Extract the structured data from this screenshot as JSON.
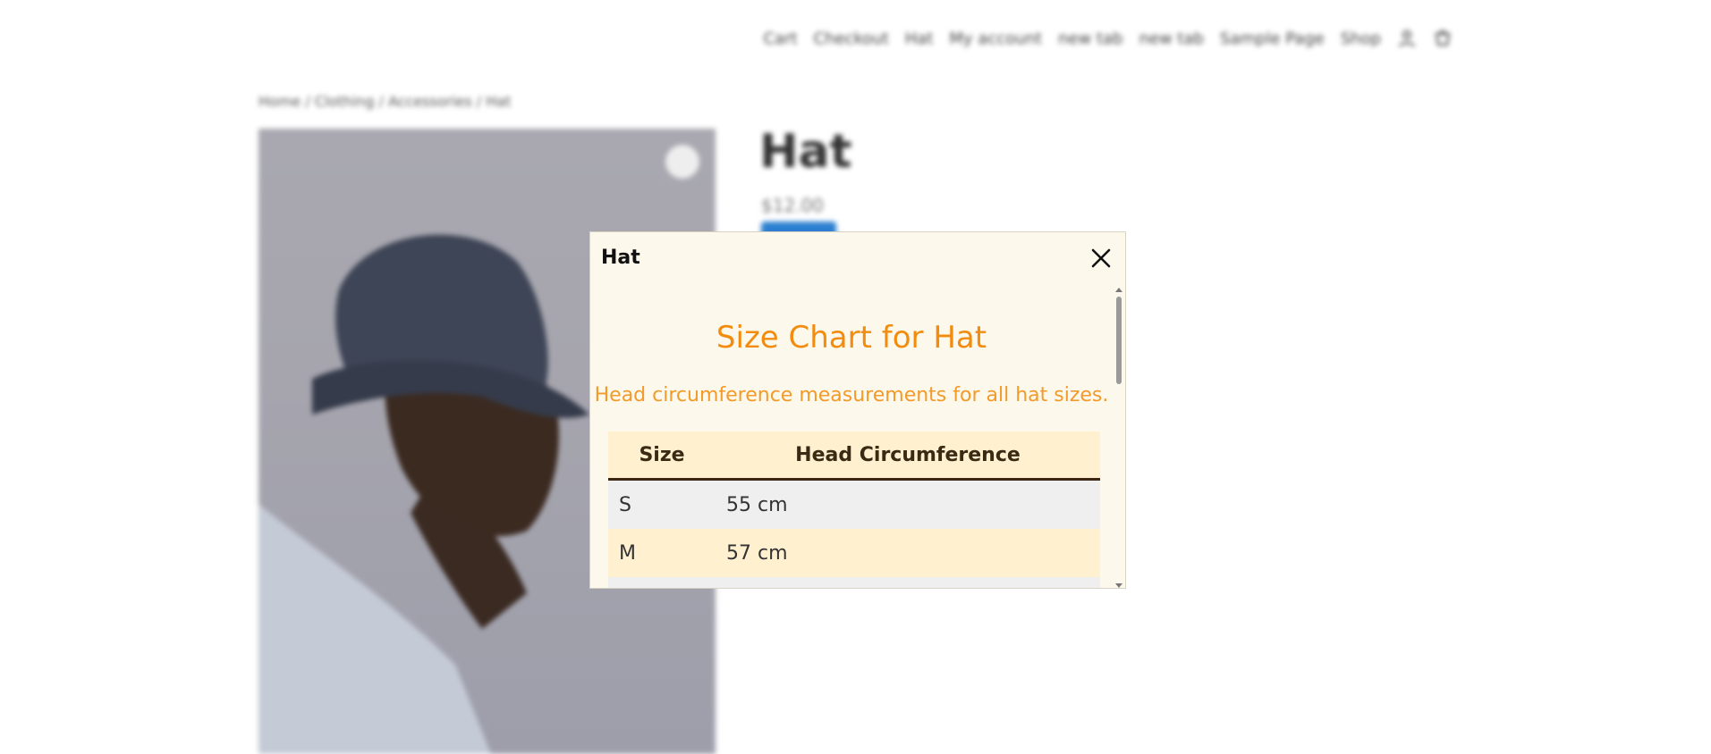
{
  "background": {
    "logo": "",
    "nav": [
      "Cart",
      "Checkout",
      "Hat",
      "My account",
      "new tab",
      "new tab",
      "Sample Page",
      "Shop"
    ],
    "breadcrumb": "Home / Clothing / Accessories / Hat",
    "product_title": "Hat",
    "product_price": "$12.00"
  },
  "modal": {
    "title": "Hat",
    "close_icon": "close-icon",
    "chart_title": "Size Chart for Hat",
    "chart_subtitle": "Head circumference measurements for all hat sizes.",
    "table": {
      "headers": [
        "Size",
        "Head Circumference"
      ],
      "rows": [
        [
          "S",
          "55 cm"
        ],
        [
          "M",
          "57 cm"
        ]
      ]
    }
  },
  "colors": {
    "accent": "#f28c0f",
    "modal_bg": "#fdf8ec",
    "table_header_bg": "#fff0cf"
  }
}
